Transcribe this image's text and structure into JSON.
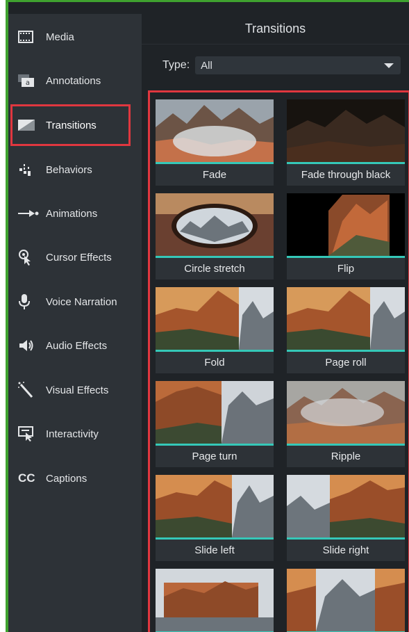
{
  "sidebar": {
    "items": [
      {
        "label": "Media",
        "icon": "film-icon"
      },
      {
        "label": "Annotations",
        "icon": "annotation-icon"
      },
      {
        "label": "Transitions",
        "icon": "transition-icon"
      },
      {
        "label": "Behaviors",
        "icon": "behaviors-icon"
      },
      {
        "label": "Animations",
        "icon": "animation-arrow-icon"
      },
      {
        "label": "Cursor Effects",
        "icon": "cursor-icon"
      },
      {
        "label": "Voice Narration",
        "icon": "microphone-icon"
      },
      {
        "label": "Audio Effects",
        "icon": "speaker-icon"
      },
      {
        "label": "Visual Effects",
        "icon": "magic-wand-icon"
      },
      {
        "label": "Interactivity",
        "icon": "interactivity-icon"
      },
      {
        "label": "Captions",
        "icon": "cc-icon"
      }
    ],
    "selected": "Transitions"
  },
  "panel": {
    "title": "Transitions",
    "type_label": "Type:",
    "type_value": "All"
  },
  "transitions": [
    {
      "label": "Fade"
    },
    {
      "label": "Fade through black"
    },
    {
      "label": "Circle stretch"
    },
    {
      "label": "Flip"
    },
    {
      "label": "Fold"
    },
    {
      "label": "Page roll"
    },
    {
      "label": "Page turn"
    },
    {
      "label": "Ripple"
    },
    {
      "label": "Slide left"
    },
    {
      "label": "Slide right"
    },
    {
      "label": ""
    },
    {
      "label": ""
    }
  ],
  "colors": {
    "accent": "#35c8b8",
    "highlight_outline": "#e0373f",
    "window_border": "#3fa22f",
    "sidebar_bg": "#2d3237",
    "panel_bg": "#1f2327"
  }
}
